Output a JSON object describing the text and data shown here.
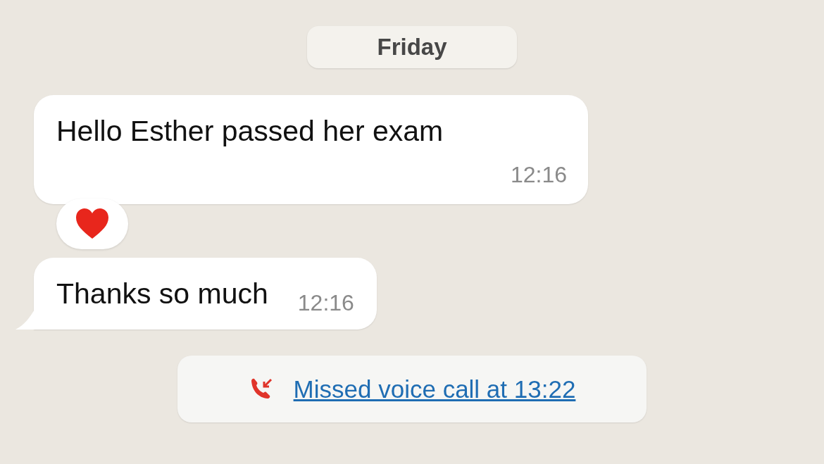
{
  "date_divider": "Friday",
  "messages": [
    {
      "kind": "stacked",
      "text": "Hello Esther passed her exam",
      "time": "12:16",
      "reaction": true,
      "tail": false
    },
    {
      "kind": "inline",
      "text": "Thanks so much",
      "time": "12:16",
      "reaction": false,
      "tail": true
    }
  ],
  "call_notice": {
    "text": "Missed voice call at 13:22",
    "missed": true
  }
}
